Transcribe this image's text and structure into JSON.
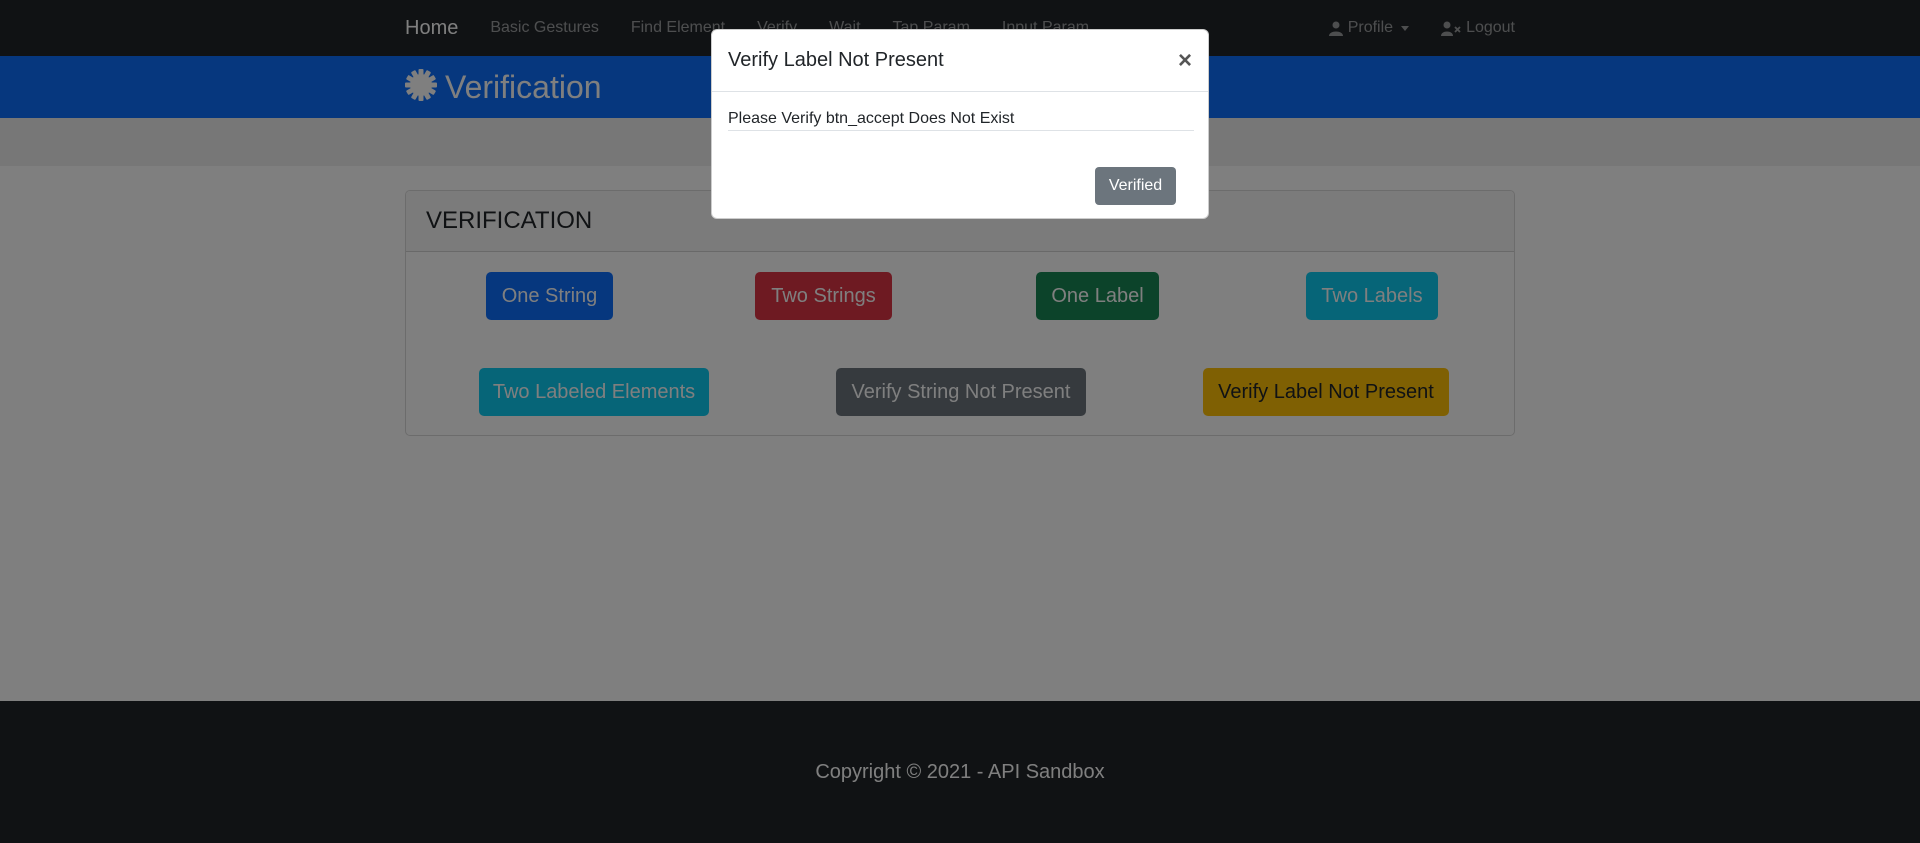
{
  "navbar": {
    "brand": "Home",
    "links": [
      "Basic Gestures",
      "Find Element",
      "Verify",
      "Wait",
      "Tap Param",
      "Input Param"
    ],
    "profile_label": "Profile",
    "logout_label": "Logout"
  },
  "header": {
    "title": "Verification"
  },
  "card": {
    "title": "VERIFICATION",
    "buttons": {
      "one_string": "One String",
      "two_strings": "Two Strings",
      "one_label": "One Label",
      "two_labels": "Two Labels",
      "two_labeled_elements": "Two Labeled Elements",
      "verify_string_not_present": "Verify String Not Present",
      "verify_label_not_present": "Verify Label Not Present"
    }
  },
  "footer": {
    "text": "Copyright © 2021 - API Sandbox"
  },
  "modal": {
    "title": "Verify Label Not Present",
    "close": "×",
    "message": "Please Verify btn_accept Does Not Exist",
    "button": "Verified"
  },
  "colors": {
    "primary": "#0d6efd",
    "danger": "#dc3545",
    "success": "#198754",
    "info": "#0dcaf0",
    "teal": "#0fa2b5",
    "secondary": "#6c757d",
    "dark_gray": "#5a6268",
    "warning": "#ffc107",
    "dark": "#212529"
  },
  "icons": {
    "header": "gear-icon",
    "profile": "user-icon",
    "logout": "user-x-icon"
  }
}
